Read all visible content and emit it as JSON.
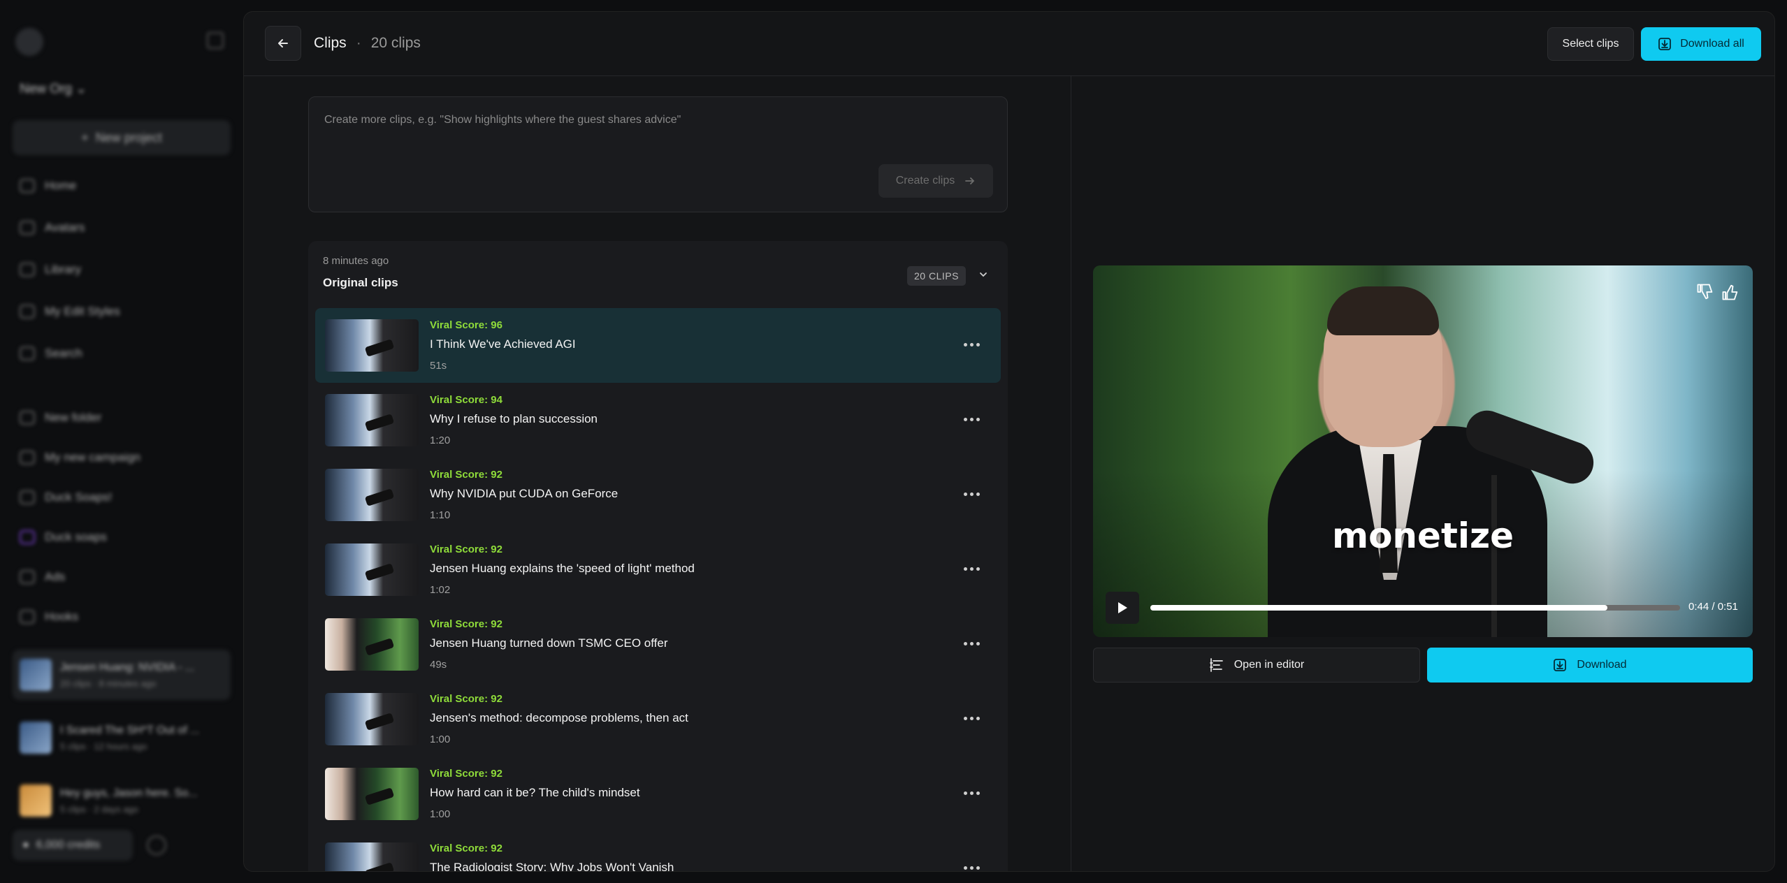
{
  "sidebar": {
    "org_name": "New Org",
    "new_project": "New project",
    "nav": [
      {
        "label": "Home",
        "icon": "home-icon"
      },
      {
        "label": "Avatars",
        "icon": "avatar-icon"
      },
      {
        "label": "Library",
        "icon": "library-icon"
      },
      {
        "label": "My Edit Styles",
        "icon": "styles-icon"
      },
      {
        "label": "Search",
        "icon": "search-icon"
      }
    ],
    "folders": [
      {
        "label": "New folder",
        "icon": "folder-icon"
      },
      {
        "label": "My new campaign",
        "icon": "campaign-icon"
      },
      {
        "label": "Duck Soaps!",
        "icon": "campaign-icon"
      },
      {
        "label": "Duck soaps",
        "icon": "campaign-icon"
      },
      {
        "label": "Ads",
        "icon": "folder-icon"
      },
      {
        "label": "Hooks",
        "icon": "folder-icon"
      }
    ],
    "recents": [
      {
        "title": "Jensen Huang: NVIDIA - ...",
        "meta": "20 clips · 8 minutes ago"
      },
      {
        "title": "I Scared The SH*T Out of ...",
        "meta": "5 clips · 12 hours ago"
      },
      {
        "title": "Hey guys, Jason here. So...",
        "meta": "5 clips · 2 days ago"
      }
    ],
    "credits": "6,000 credits"
  },
  "header": {
    "title": "Clips",
    "separator": "·",
    "clip_count": "20 clips",
    "select_label": "Select clips",
    "download_all_label": "Download all"
  },
  "prompt": {
    "placeholder": "Create more clips, e.g. \"Show highlights where the guest shares advice\"",
    "create_label": "Create clips"
  },
  "clips_group": {
    "time_ago": "8 minutes ago",
    "title": "Original clips",
    "badge": "20 CLIPS",
    "items": [
      {
        "score": "Viral Score: 96",
        "title": "I Think We've Achieved AGI",
        "duration": "51s"
      },
      {
        "score": "Viral Score: 94",
        "title": "Why I refuse to plan succession",
        "duration": "1:20"
      },
      {
        "score": "Viral Score: 92",
        "title": "Why NVIDIA put CUDA on GeForce",
        "duration": "1:10"
      },
      {
        "score": "Viral Score: 92",
        "title": "Jensen Huang explains the 'speed of light' method",
        "duration": "1:02"
      },
      {
        "score": "Viral Score: 92",
        "title": "Jensen Huang turned down TSMC CEO offer",
        "duration": "49s"
      },
      {
        "score": "Viral Score: 92",
        "title": "Jensen's method: decompose problems, then act",
        "duration": "1:00"
      },
      {
        "score": "Viral Score: 92",
        "title": "How hard can it be? The child's mindset",
        "duration": "1:00"
      },
      {
        "score": "Viral Score: 92",
        "title": "The Radiologist Story: Why Jobs Won't Vanish",
        "duration": ""
      }
    ]
  },
  "player": {
    "caption": "monetize",
    "time": "0:44 / 0:51",
    "progress": 0.863,
    "open_editor_label": "Open in editor",
    "download_label": "Download"
  },
  "colors": {
    "accent": "#0fcaf0",
    "viral_score": "#8fdc3a",
    "selected_row": "#183036"
  }
}
